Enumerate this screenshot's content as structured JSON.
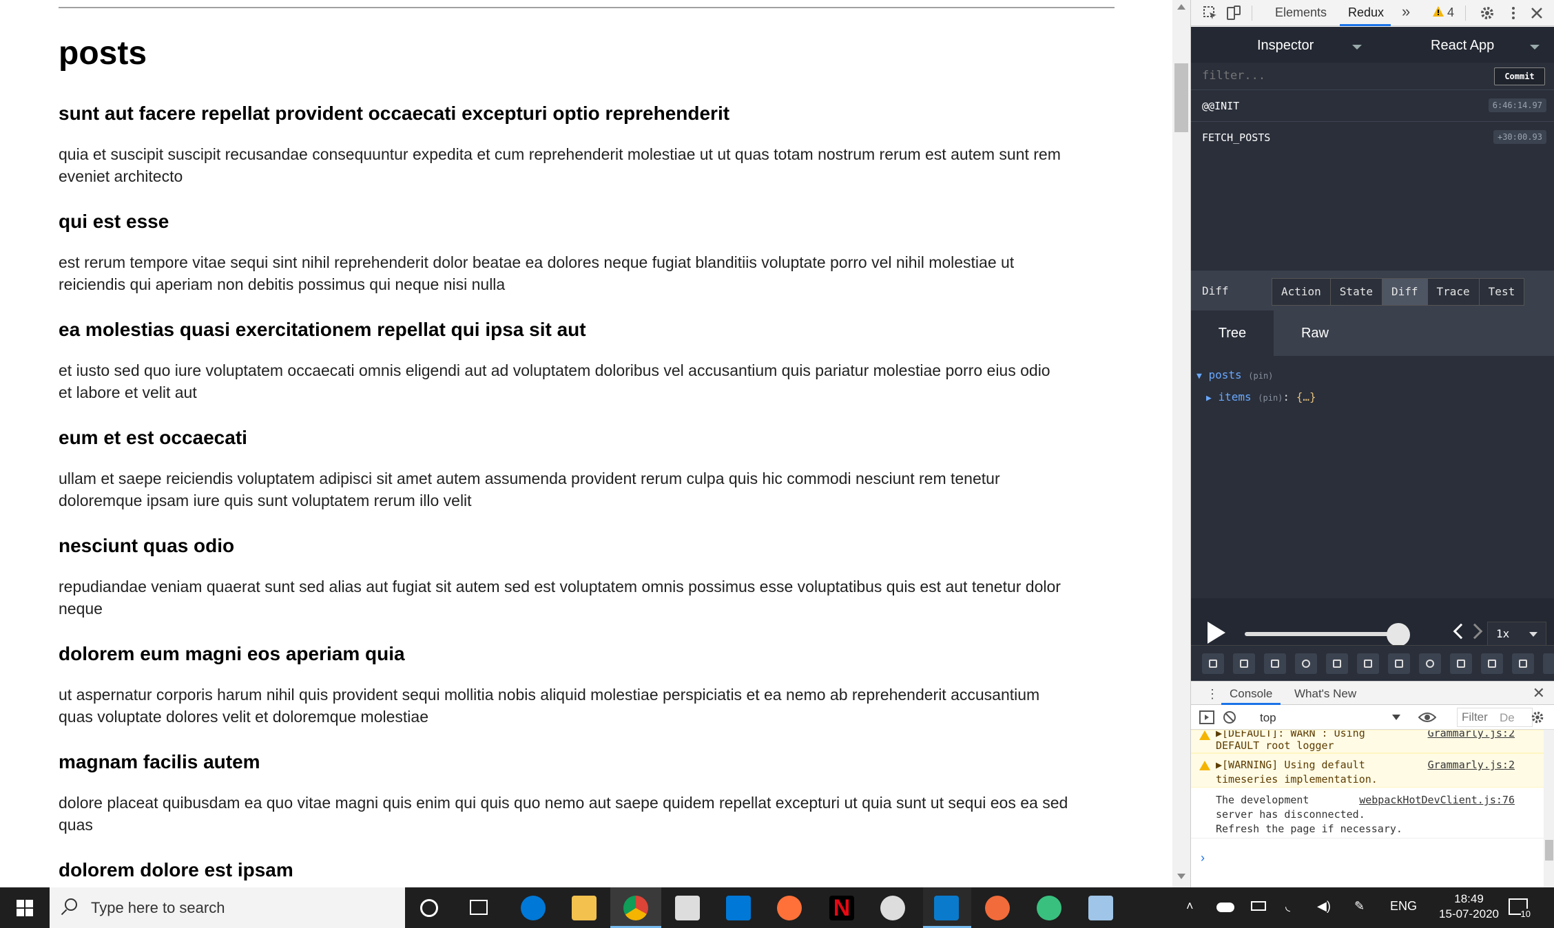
{
  "page": {
    "heading": "posts",
    "posts": [
      {
        "title": "sunt aut facere repellat provident occaecati excepturi optio reprehenderit",
        "body_line1": "quia et suscipit suscipit recusandae consequuntur expedita et cum reprehenderit molestiae ut ut quas totam nostrum rerum est autem sunt rem",
        "body_line2": "eveniet architecto"
      },
      {
        "title": "qui est esse",
        "body_line1": "est rerum tempore vitae sequi sint nihil reprehenderit dolor beatae ea dolores neque fugiat blanditiis voluptate porro vel nihil molestiae ut",
        "body_line2": "reiciendis qui aperiam non debitis possimus qui neque nisi nulla"
      },
      {
        "title": "ea molestias quasi exercitationem repellat qui ipsa sit aut",
        "body_line1": "et iusto sed quo iure voluptatem occaecati omnis eligendi aut ad voluptatem doloribus vel accusantium quis pariatur molestiae porro eius odio",
        "body_line2": "et labore et velit aut"
      },
      {
        "title": "eum et est occaecati",
        "body_line1": "ullam et saepe reiciendis voluptatem adipisci sit amet autem assumenda provident rerum culpa quis hic commodi nesciunt rem tenetur",
        "body_line2": "doloremque ipsam iure quis sunt voluptatem rerum illo velit"
      },
      {
        "title": "nesciunt quas odio",
        "body_line1": "repudiandae veniam quaerat sunt sed alias aut fugiat sit autem sed est voluptatem omnis possimus esse voluptatibus quis est aut tenetur dolor",
        "body_line2": "neque"
      },
      {
        "title": "dolorem eum magni eos aperiam quia",
        "body_line1": "ut aspernatur corporis harum nihil quis provident sequi mollitia nobis aliquid molestiae perspiciatis et ea nemo ab reprehenderit accusantium",
        "body_line2": "quas voluptate dolores velit et doloremque molestiae"
      },
      {
        "title": "magnam facilis autem",
        "body_line1": "dolore placeat quibusdam ea quo vitae magni quis enim qui quis quo nemo aut saepe quidem repellat excepturi ut quia sunt ut sequi eos ea sed",
        "body_line2": "quas"
      },
      {
        "title": "dolorem dolore est ipsam",
        "body_line1": "",
        "body_line2": ""
      }
    ]
  },
  "devtools": {
    "tabs": {
      "elements": "Elements",
      "redux": "Redux",
      "more": "»",
      "warnings": "4"
    },
    "redux": {
      "monitor_select": "Inspector",
      "instance_select": "React App",
      "filter_placeholder": "filter...",
      "commit_label": "Commit",
      "actions": [
        {
          "name": "@@INIT",
          "time": "6:46:14.97"
        },
        {
          "name": "FETCH_POSTS",
          "time": "+30:00.93"
        }
      ],
      "panel_label": "Diff",
      "panel_tabs": [
        "Action",
        "State",
        "Diff",
        "Trace",
        "Test"
      ],
      "active_panel_tab": "Diff",
      "view_tabs": [
        "Tree",
        "Raw"
      ],
      "tree": {
        "root_key": "posts",
        "root_pin": "(pin)",
        "child_key": "items",
        "child_pin": "(pin)",
        "child_value": "{…}"
      },
      "speed": "1x",
      "slider_position": 1.0
    },
    "console": {
      "tabs": [
        "Console",
        "What's New"
      ],
      "context": "top",
      "filter_placeholder": "Filter",
      "default_levels_abbrev": "De",
      "messages": [
        {
          "level": "warn",
          "line1": "▶[DEFAULT]: WARN : Using",
          "line2": "DEFAULT root logger",
          "source": "Grammarly.js:2"
        },
        {
          "level": "warn",
          "line1": "▶[WARNING] Using default",
          "line2": "timeseries implementation.",
          "source": "Grammarly.js:2"
        },
        {
          "level": "info",
          "line1": "The development",
          "line2": "server has disconnected.",
          "line3": "Refresh the page if necessary.",
          "source": "webpackHotDevClient.js:76"
        }
      ],
      "prompt": "›"
    }
  },
  "taskbar": {
    "search_placeholder": "Type here to search",
    "language": "ENG",
    "time": "18:49",
    "date": "15-07-2020",
    "notifications": "10"
  },
  "colors": {
    "redux_bg": "#2a2f3a",
    "accent_blue": "#1a73e8",
    "tree_key": "#6aa9ff",
    "warn_bg": "#fffbe5"
  }
}
